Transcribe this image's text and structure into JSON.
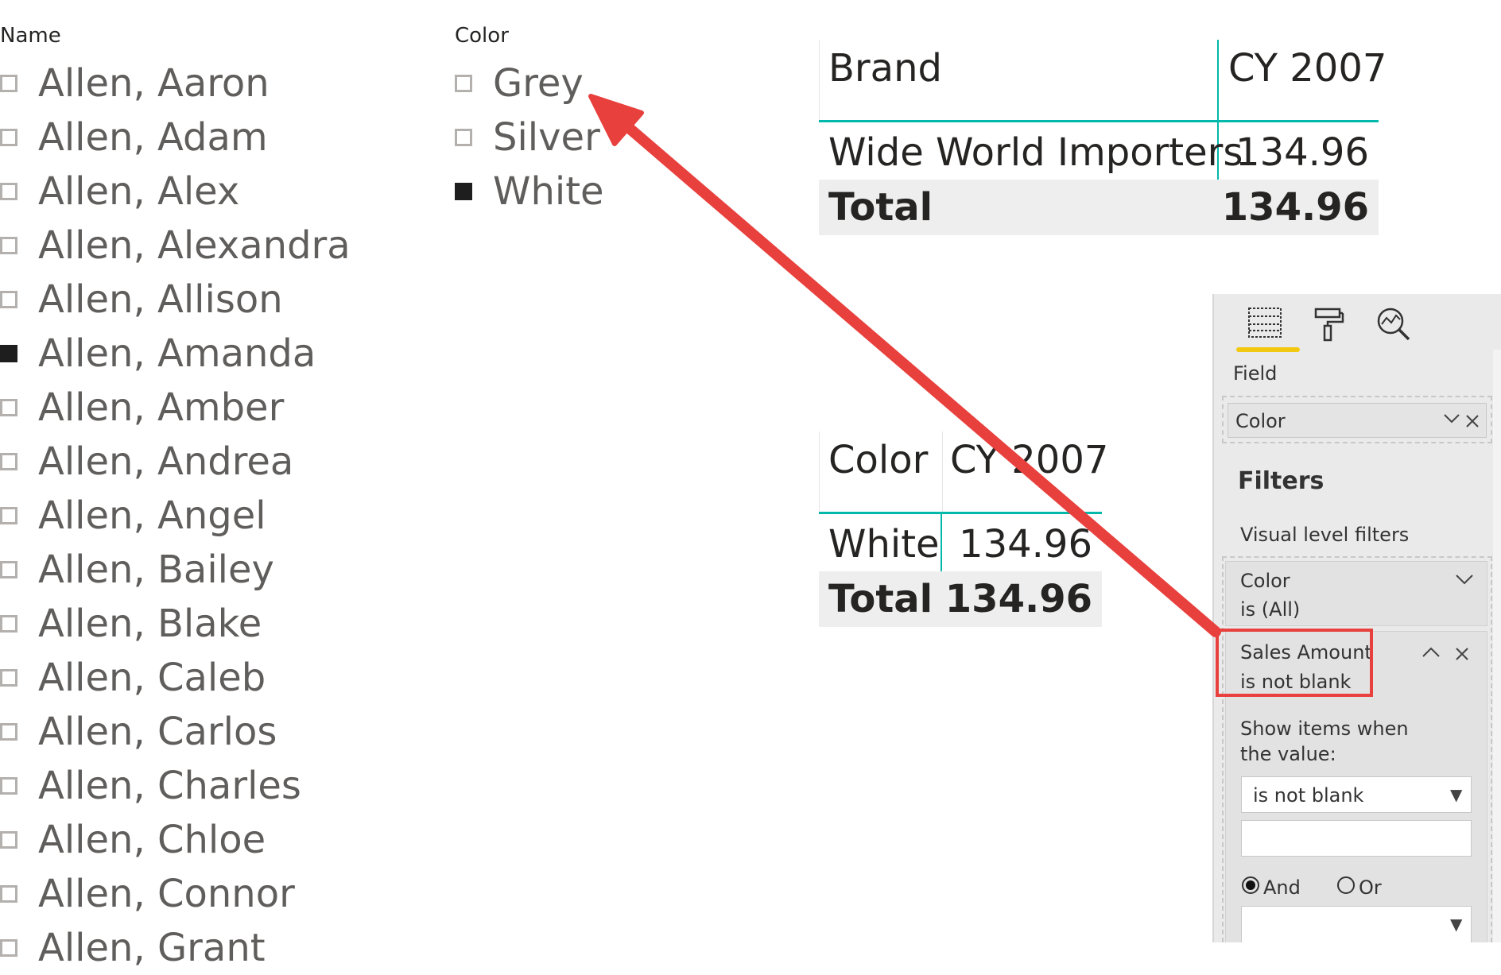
{
  "name_slicer": {
    "title": "Name",
    "items": [
      {
        "label": "Allen, Aaron",
        "checked": false
      },
      {
        "label": "Allen, Adam",
        "checked": false
      },
      {
        "label": "Allen, Alex",
        "checked": false
      },
      {
        "label": "Allen, Alexandra",
        "checked": false
      },
      {
        "label": "Allen, Allison",
        "checked": false
      },
      {
        "label": "Allen, Amanda",
        "checked": true
      },
      {
        "label": "Allen, Amber",
        "checked": false
      },
      {
        "label": "Allen, Andrea",
        "checked": false
      },
      {
        "label": "Allen, Angel",
        "checked": false
      },
      {
        "label": "Allen, Bailey",
        "checked": false
      },
      {
        "label": "Allen, Blake",
        "checked": false
      },
      {
        "label": "Allen, Caleb",
        "checked": false
      },
      {
        "label": "Allen, Carlos",
        "checked": false
      },
      {
        "label": "Allen, Charles",
        "checked": false
      },
      {
        "label": "Allen, Chloe",
        "checked": false
      },
      {
        "label": "Allen, Connor",
        "checked": false
      },
      {
        "label": "Allen, Grant",
        "checked": false
      }
    ]
  },
  "color_slicer": {
    "title": "Color",
    "items": [
      {
        "label": "Grey",
        "checked": false
      },
      {
        "label": "Silver",
        "checked": false
      },
      {
        "label": "White",
        "checked": true
      }
    ]
  },
  "brand_table": {
    "headers": [
      "Brand",
      "CY 2007"
    ],
    "row": {
      "label": "Wide World Importers",
      "value": "134.96"
    },
    "total": {
      "label": "Total",
      "value": "134.96"
    }
  },
  "color_table": {
    "headers": [
      "Color",
      "CY 2007"
    ],
    "row": {
      "label": "White",
      "value": "134.96"
    },
    "total": {
      "label": "Total",
      "value": "134.96"
    }
  },
  "pane": {
    "tabs": [
      "fields-icon",
      "format-paint-roller-icon",
      "analytics-magnifier-icon"
    ],
    "field_label": "Field",
    "field_value": "Color",
    "filters_title": "Filters",
    "visual_level_label": "Visual level filters",
    "color_filter": {
      "name": "Color",
      "summary": "is (All)"
    },
    "sales_filter": {
      "name": "Sales Amount",
      "summary": "is not blank"
    },
    "show_items_label": "Show items when the value:",
    "condition_value": "is not blank",
    "second_value": "",
    "and_label": "And",
    "or_label": "Or",
    "and_selected": true
  },
  "colors": {
    "accent_teal": "#01b8aa",
    "annotation_red": "#e8403d",
    "tab_underline": "#f2c811",
    "total_row_bg": "#eeeeee"
  }
}
